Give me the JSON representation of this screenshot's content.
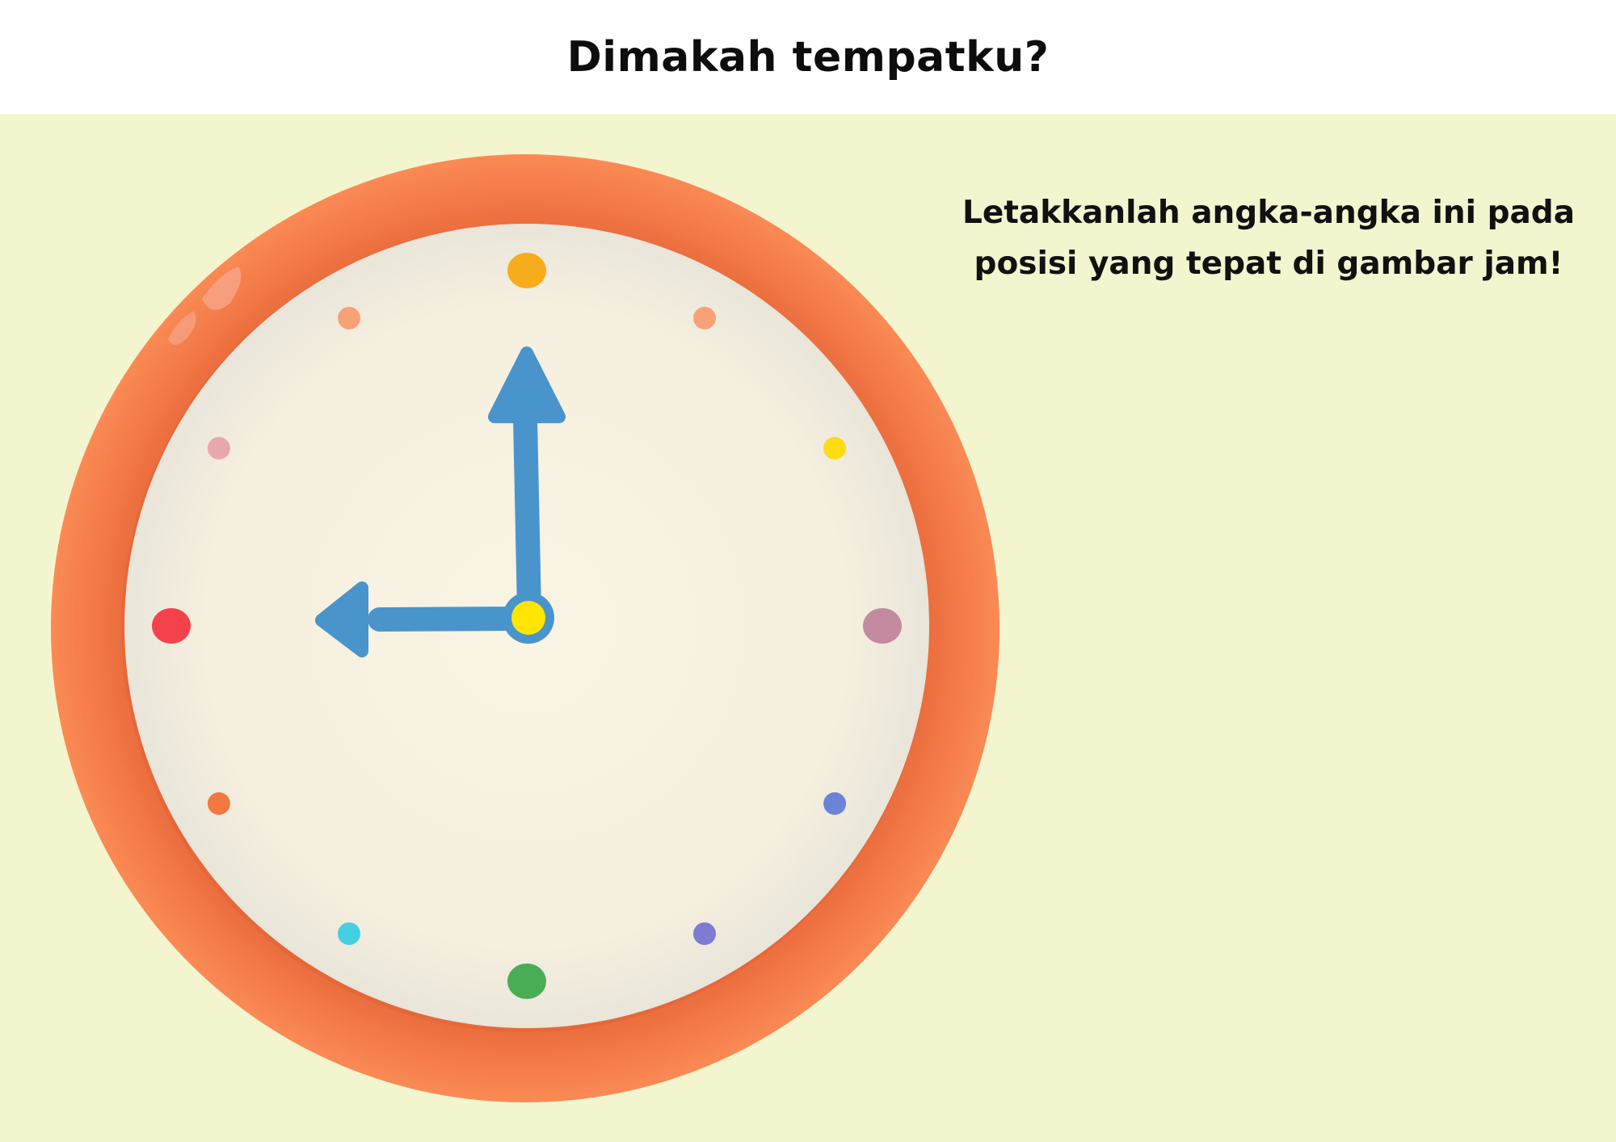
{
  "page": {
    "title": "Dimakah tempatku?",
    "instruction": "Letakkanlah angka-angka ini pada posisi yang tepat di gambar jam!"
  },
  "clock": {
    "hands": {
      "hour": "9",
      "minute": "12"
    },
    "colors": {
      "rim": "#ee7140",
      "face": "#f6f1e2",
      "hands": "#4a94cc",
      "center": "#ffe500",
      "background": "#f3f5ce"
    },
    "markers": [
      {
        "hour": 12,
        "color": "#f7ac1b"
      },
      {
        "hour": 1,
        "color": "#f8a177"
      },
      {
        "hour": 2,
        "color": "#ffdb12"
      },
      {
        "hour": 3,
        "color": "#c48aa0"
      },
      {
        "hour": 4,
        "color": "#6b84d8"
      },
      {
        "hour": 5,
        "color": "#7e7bd4"
      },
      {
        "hour": 6,
        "color": "#49ad55"
      },
      {
        "hour": 7,
        "color": "#45cfe0"
      },
      {
        "hour": 8,
        "color": "#f4773f"
      },
      {
        "hour": 9,
        "color": "#f5414b"
      },
      {
        "hour": 10,
        "color": "#e8a7ac"
      },
      {
        "hour": 11,
        "color": "#f8a176"
      }
    ]
  }
}
